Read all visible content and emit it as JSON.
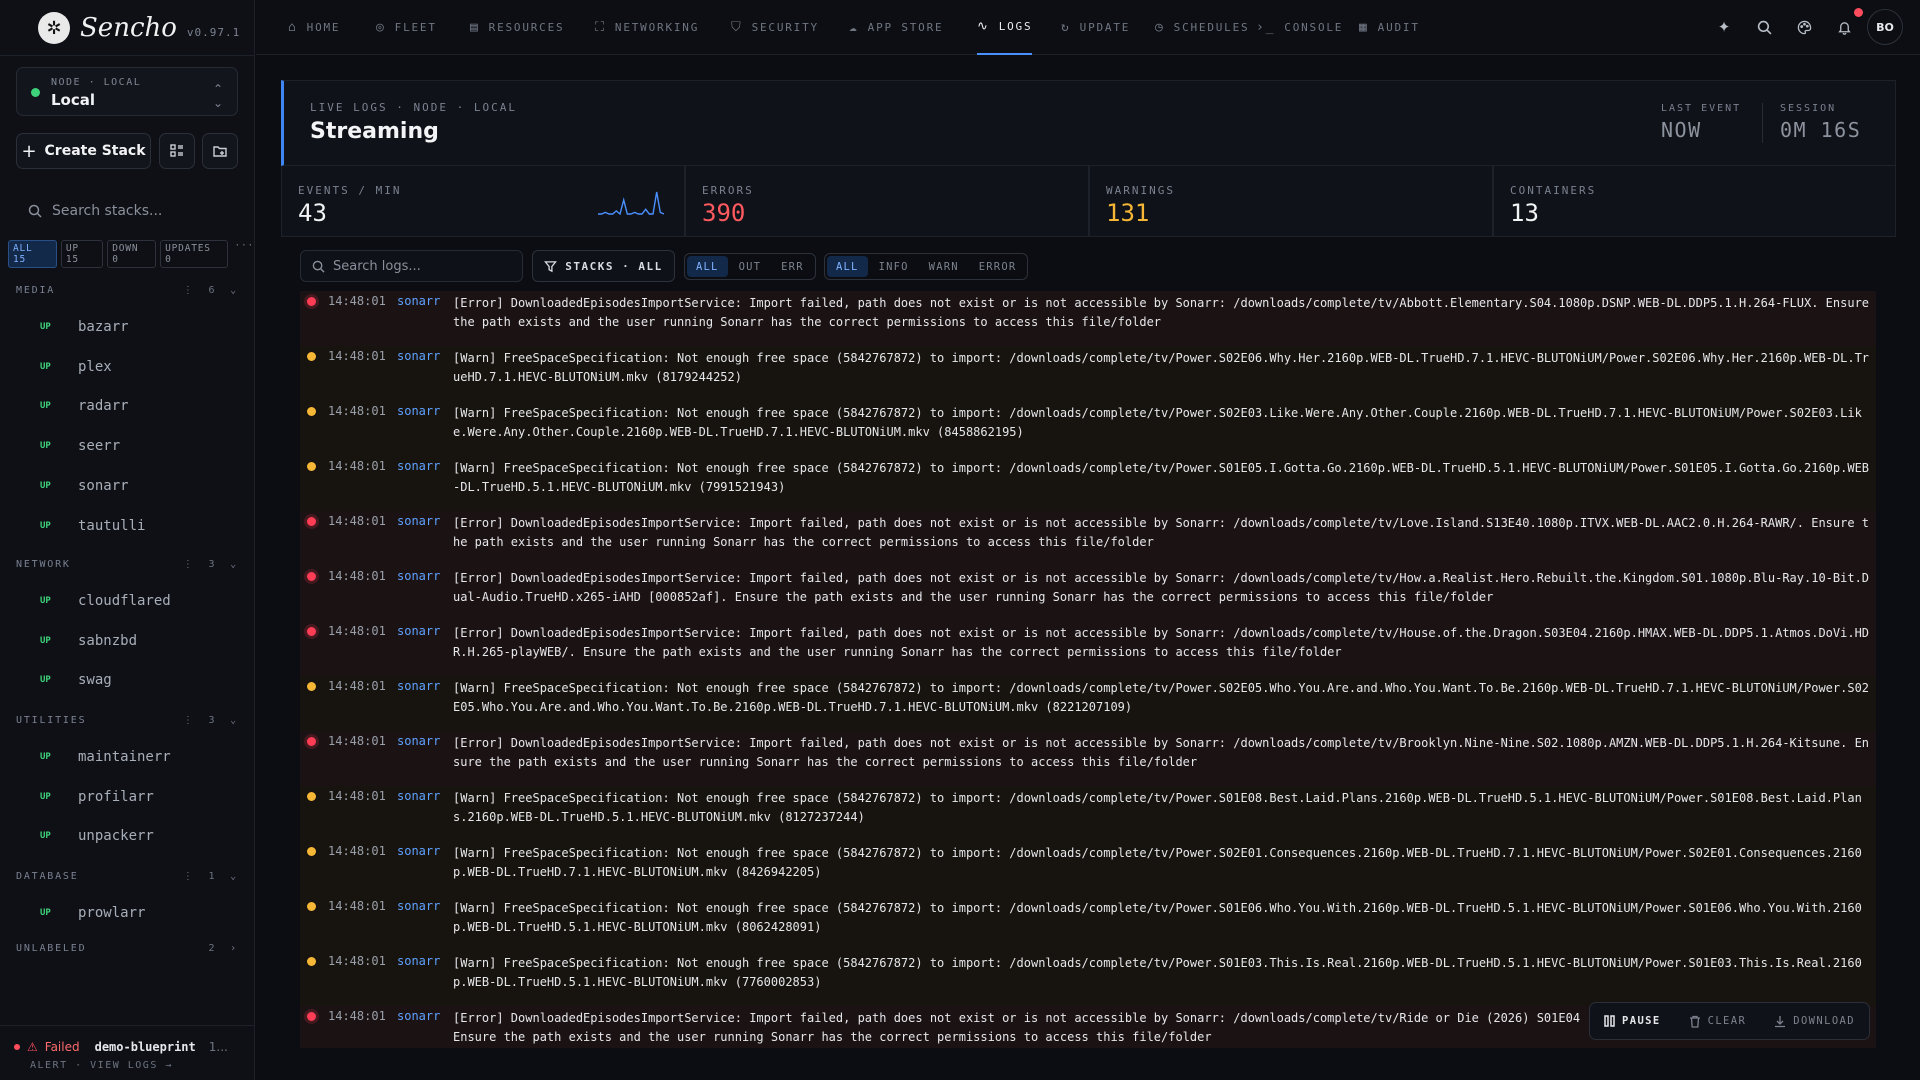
{
  "brand": {
    "name": "Sencho",
    "version": "v0.97.1"
  },
  "node": {
    "kicker": "NODE · LOCAL",
    "name": "Local"
  },
  "sidebar": {
    "create_label": "Create Stack",
    "search_placeholder": "Search stacks...",
    "filters": [
      "ALL 15",
      "UP 15",
      "DOWN 0",
      "UPDATES 0"
    ],
    "filters_more": "···",
    "groups": [
      {
        "name": "MEDIA",
        "count": "6",
        "items": [
          {
            "status": "UP",
            "name": "bazarr"
          },
          {
            "status": "UP",
            "name": "plex"
          },
          {
            "status": "UP",
            "name": "radarr"
          },
          {
            "status": "UP",
            "name": "seerr"
          },
          {
            "status": "UP",
            "name": "sonarr"
          },
          {
            "status": "UP",
            "name": "tautulli"
          }
        ]
      },
      {
        "name": "NETWORK",
        "count": "3",
        "items": [
          {
            "status": "UP",
            "name": "cloudflared"
          },
          {
            "status": "UP",
            "name": "sabnzbd"
          },
          {
            "status": "UP",
            "name": "swag"
          }
        ]
      },
      {
        "name": "UTILITIES",
        "count": "3",
        "items": [
          {
            "status": "UP",
            "name": "maintainerr"
          },
          {
            "status": "UP",
            "name": "profilarr"
          },
          {
            "status": "UP",
            "name": "unpackerr"
          }
        ]
      },
      {
        "name": "DATABASE",
        "count": "1",
        "items": [
          {
            "status": "UP",
            "name": "prowlarr"
          }
        ]
      },
      {
        "name": "UNLABELED",
        "count": "2",
        "items": []
      }
    ],
    "footer": {
      "status": "Failed",
      "name": "demo-blueprint",
      "extra": "1...",
      "link": "ALERT · VIEW LOGS →"
    }
  },
  "nav": {
    "items": [
      "HOME",
      "FLEET",
      "RESOURCES",
      "NETWORKING",
      "SECURITY",
      "APP STORE",
      "LOGS",
      "UPDATE",
      "SCHEDULES",
      "CONSOLE",
      "AUDIT"
    ],
    "active": "LOGS"
  },
  "user": {
    "initials": "BO"
  },
  "header": {
    "kicker": "LIVE LOGS · NODE · LOCAL",
    "title": "Streaming",
    "last_event_label": "LAST EVENT",
    "last_event": "NOW",
    "session_label": "SESSION",
    "session": "0M 16S"
  },
  "stats": [
    {
      "label": "EVENTS / MIN",
      "value": "43",
      "color": "#f2f3f5"
    },
    {
      "label": "ERRORS",
      "value": "390",
      "color": "#ff5a5f"
    },
    {
      "label": "WARNINGS",
      "value": "131",
      "color": "#f5b735"
    },
    {
      "label": "CONTAINERS",
      "value": "13",
      "color": "#f2f3f5"
    }
  ],
  "sparkline": [
    0,
    0,
    1,
    0,
    0,
    2,
    0,
    9,
    0,
    0,
    1,
    0,
    0,
    3,
    0,
    0,
    14,
    1,
    0
  ],
  "toolbar": {
    "search_placeholder": "Search logs...",
    "stacks_label": "STACKS · ALL",
    "stream_filters": [
      "ALL",
      "OUT",
      "ERR"
    ],
    "level_filters": [
      "ALL",
      "INFO",
      "WARN",
      "ERROR"
    ],
    "active": "ALL"
  },
  "logs": [
    {
      "level": "err",
      "time": "14:48:01",
      "source": "sonarr",
      "msg": "[Error] DownloadedEpisodesImportService: Import failed, path does not exist or is not accessible by Sonarr: /downloads/complete/tv/Abbott.Elementary.S04.1080p.DSNP.WEB-DL.DDP5.1.H.264-FLUX. Ensure the path exists and the user running Sonarr has the correct permissions to access this file/folder"
    },
    {
      "level": "warn",
      "time": "14:48:01",
      "source": "sonarr",
      "msg": "[Warn] FreeSpaceSpecification: Not enough free space (5842767872) to import: /downloads/complete/tv/Power.S02E06.Why.Her.2160p.WEB-DL.TrueHD.7.1.HEVC-BLUTONiUM/Power.S02E06.Why.Her.2160p.WEB-DL.TrueHD.7.1.HEVC-BLUTONiUM.mkv (8179244252)"
    },
    {
      "level": "warn",
      "time": "14:48:01",
      "source": "sonarr",
      "msg": "[Warn] FreeSpaceSpecification: Not enough free space (5842767872) to import: /downloads/complete/tv/Power.S02E03.Like.Were.Any.Other.Couple.2160p.WEB-DL.TrueHD.7.1.HEVC-BLUTONiUM/Power.S02E03.Like.Were.Any.Other.Couple.2160p.WEB-DL.TrueHD.7.1.HEVC-BLUTONiUM.mkv (8458862195)"
    },
    {
      "level": "warn",
      "time": "14:48:01",
      "source": "sonarr",
      "msg": "[Warn] FreeSpaceSpecification: Not enough free space (5842767872) to import: /downloads/complete/tv/Power.S01E05.I.Gotta.Go.2160p.WEB-DL.TrueHD.5.1.HEVC-BLUTONiUM/Power.S01E05.I.Gotta.Go.2160p.WEB-DL.TrueHD.5.1.HEVC-BLUTONiUM.mkv (7991521943)"
    },
    {
      "level": "err",
      "time": "14:48:01",
      "source": "sonarr",
      "msg": "[Error] DownloadedEpisodesImportService: Import failed, path does not exist or is not accessible by Sonarr: /downloads/complete/tv/Love.Island.S13E40.1080p.ITVX.WEB-DL.AAC2.0.H.264-RAWR/. Ensure the path exists and the user running Sonarr has the correct permissions to access this file/folder"
    },
    {
      "level": "err",
      "time": "14:48:01",
      "source": "sonarr",
      "msg": "[Error] DownloadedEpisodesImportService: Import failed, path does not exist or is not accessible by Sonarr: /downloads/complete/tv/How.a.Realist.Hero.Rebuilt.the.Kingdom.S01.1080p.Blu-Ray.10-Bit.Dual-Audio.TrueHD.x265-iAHD [000852af]. Ensure the path exists and the user running Sonarr has the correct permissions to access this file/folder"
    },
    {
      "level": "err",
      "time": "14:48:01",
      "source": "sonarr",
      "msg": "[Error] DownloadedEpisodesImportService: Import failed, path does not exist or is not accessible by Sonarr: /downloads/complete/tv/House.of.the.Dragon.S03E04.2160p.HMAX.WEB-DL.DDP5.1.Atmos.DoVi.HDR.H.265-playWEB/. Ensure the path exists and the user running Sonarr has the correct permissions to access this file/folder"
    },
    {
      "level": "warn",
      "time": "14:48:01",
      "source": "sonarr",
      "msg": "[Warn] FreeSpaceSpecification: Not enough free space (5842767872) to import: /downloads/complete/tv/Power.S02E05.Who.You.Are.and.Who.You.Want.To.Be.2160p.WEB-DL.TrueHD.7.1.HEVC-BLUTONiUM/Power.S02E05.Who.You.Are.and.Who.You.Want.To.Be.2160p.WEB-DL.TrueHD.7.1.HEVC-BLUTONiUM.mkv (8221207109)"
    },
    {
      "level": "err",
      "time": "14:48:01",
      "source": "sonarr",
      "msg": "[Error] DownloadedEpisodesImportService: Import failed, path does not exist or is not accessible by Sonarr: /downloads/complete/tv/Brooklyn.Nine-Nine.S02.1080p.AMZN.WEB-DL.DDP5.1.H.264-Kitsune. Ensure the path exists and the user running Sonarr has the correct permissions to access this file/folder"
    },
    {
      "level": "warn",
      "time": "14:48:01",
      "source": "sonarr",
      "msg": "[Warn] FreeSpaceSpecification: Not enough free space (5842767872) to import: /downloads/complete/tv/Power.S01E08.Best.Laid.Plans.2160p.WEB-DL.TrueHD.5.1.HEVC-BLUTONiUM/Power.S01E08.Best.Laid.Plans.2160p.WEB-DL.TrueHD.5.1.HEVC-BLUTONiUM.mkv (8127237244)"
    },
    {
      "level": "warn",
      "time": "14:48:01",
      "source": "sonarr",
      "msg": "[Warn] FreeSpaceSpecification: Not enough free space (5842767872) to import: /downloads/complete/tv/Power.S02E01.Consequences.2160p.WEB-DL.TrueHD.7.1.HEVC-BLUTONiUM/Power.S02E01.Consequences.2160p.WEB-DL.TrueHD.7.1.HEVC-BLUTONiUM.mkv (8426942205)"
    },
    {
      "level": "warn",
      "time": "14:48:01",
      "source": "sonarr",
      "msg": "[Warn] FreeSpaceSpecification: Not enough free space (5842767872) to import: /downloads/complete/tv/Power.S01E06.Who.You.With.2160p.WEB-DL.TrueHD.5.1.HEVC-BLUTONiUM/Power.S01E06.Who.You.With.2160p.WEB-DL.TrueHD.5.1.HEVC-BLUTONiUM.mkv (8062428091)"
    },
    {
      "level": "warn",
      "time": "14:48:01",
      "source": "sonarr",
      "msg": "[Warn] FreeSpaceSpecification: Not enough free space (5842767872) to import: /downloads/complete/tv/Power.S01E03.This.Is.Real.2160p.WEB-DL.TrueHD.5.1.HEVC-BLUTONiUM/Power.S01E03.This.Is.Real.2160p.WEB-DL.TrueHD.5.1.HEVC-BLUTONiUM.mkv (7760002853)"
    },
    {
      "level": "err",
      "time": "14:48:01",
      "source": "sonarr",
      "msg": "[Error] DownloadedEpisodesImportService: Import failed, path does not exist or is not accessible by Sonarr: /downloads/complete/tv/Ride or Die (2026) S01E04 (... + DDP Atmos 5.1 English - HONE)/. Ensure the path exists and the user running Sonarr has the correct permissions to access this file/folder"
    }
  ],
  "controls": {
    "pause": "PAUSE",
    "clear": "CLEAR",
    "download": "DOWNLOAD"
  }
}
